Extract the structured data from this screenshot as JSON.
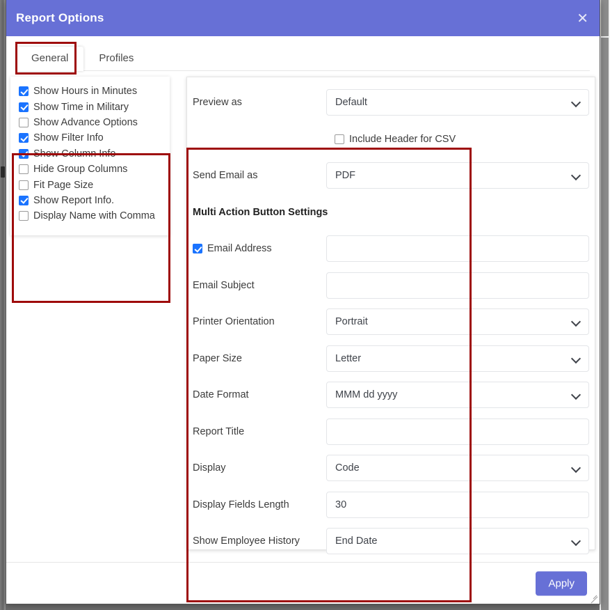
{
  "window": {
    "title": "Report Options",
    "close_icon": "close-icon"
  },
  "tabs": [
    {
      "label": "General",
      "active": true
    },
    {
      "label": "Profiles",
      "active": false
    }
  ],
  "options": {
    "items": [
      {
        "label": "Show Hours in Minutes",
        "checked": true
      },
      {
        "label": "Show Time in Military",
        "checked": true
      },
      {
        "label": "Show Advance Options",
        "checked": false
      },
      {
        "label": "Show Filter Info",
        "checked": true
      },
      {
        "label": "Show Column Info",
        "checked": true
      },
      {
        "label": "Hide Group Columns",
        "checked": false
      },
      {
        "label": "Fit Page Size",
        "checked": false
      },
      {
        "label": "Show Report Info.",
        "checked": true
      },
      {
        "label": "Display Name with Comma",
        "checked": false
      }
    ]
  },
  "form": {
    "preview_as": {
      "label": "Preview as",
      "value": "Default",
      "type": "select",
      "chevron": "chevron-down-icon"
    },
    "include_header_csv": {
      "label": "Include Header for CSV",
      "checked": false
    },
    "send_email_as": {
      "label": "Send Email as",
      "value": "PDF",
      "type": "select",
      "chevron": "chevron-down-icon"
    },
    "section_heading": "Multi Action Button Settings",
    "email_address": {
      "label": "Email Address",
      "checked": true,
      "value": "",
      "placeholder": "",
      "type": "text"
    },
    "email_subject": {
      "label": "Email Subject",
      "value": "",
      "placeholder": "",
      "type": "text"
    },
    "printer_orientation": {
      "label": "Printer Orientation",
      "value": "Portrait",
      "type": "select",
      "chevron": "chevron-down-icon"
    },
    "paper_size": {
      "label": "Paper Size",
      "value": "Letter",
      "type": "select",
      "chevron": "chevron-down-icon"
    },
    "date_format": {
      "label": "Date Format",
      "value": "MMM dd yyyy",
      "type": "select",
      "chevron": "chevron-down-icon"
    },
    "report_title": {
      "label": "Report Title",
      "value": "",
      "placeholder": "",
      "type": "text"
    },
    "display": {
      "label": "Display",
      "value": "Code",
      "type": "select",
      "chevron": "chevron-down-icon"
    },
    "display_fields_length": {
      "label": "Display Fields Length",
      "value": "30",
      "placeholder": "",
      "type": "text"
    },
    "show_employee_history": {
      "label": "Show Employee History",
      "value": "End Date",
      "type": "select",
      "chevron": "chevron-down-icon"
    }
  },
  "footer": {
    "apply_label": "Apply",
    "resize_handle": "resize-grip-icon"
  },
  "colors": {
    "header_purple": "#6770d6",
    "checkbox_blue": "#1a73ff",
    "annotation_red": "#9e0b0b",
    "field_border": "#e3e5e8"
  }
}
